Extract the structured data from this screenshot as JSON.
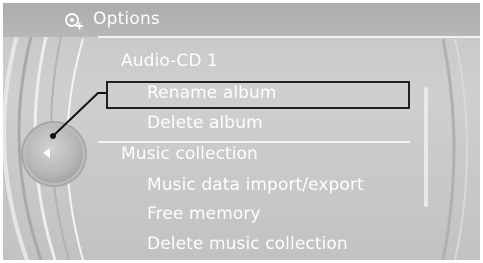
{
  "header": {
    "title": "Options",
    "icon": "options-icon"
  },
  "menu": {
    "items": [
      {
        "label": "Audio-CD 1",
        "level": 1,
        "selected": false
      },
      {
        "label": "Rename album",
        "level": 2,
        "selected": true
      },
      {
        "label": "Delete album",
        "level": 2,
        "selected": false
      },
      {
        "label": "Music collection",
        "level": 1,
        "selected": false
      },
      {
        "label": "Music data import/export",
        "level": 2,
        "selected": false
      },
      {
        "label": "Free memory",
        "level": 2,
        "selected": false
      },
      {
        "label": "Delete music collection",
        "level": 2,
        "selected": false
      }
    ]
  },
  "controller": {
    "icon": "left-arrow-icon"
  },
  "colors": {
    "text": "#ffffff",
    "background": "#c8c8c8",
    "selection_frame": "#202020",
    "pointer_line": "#111111"
  }
}
